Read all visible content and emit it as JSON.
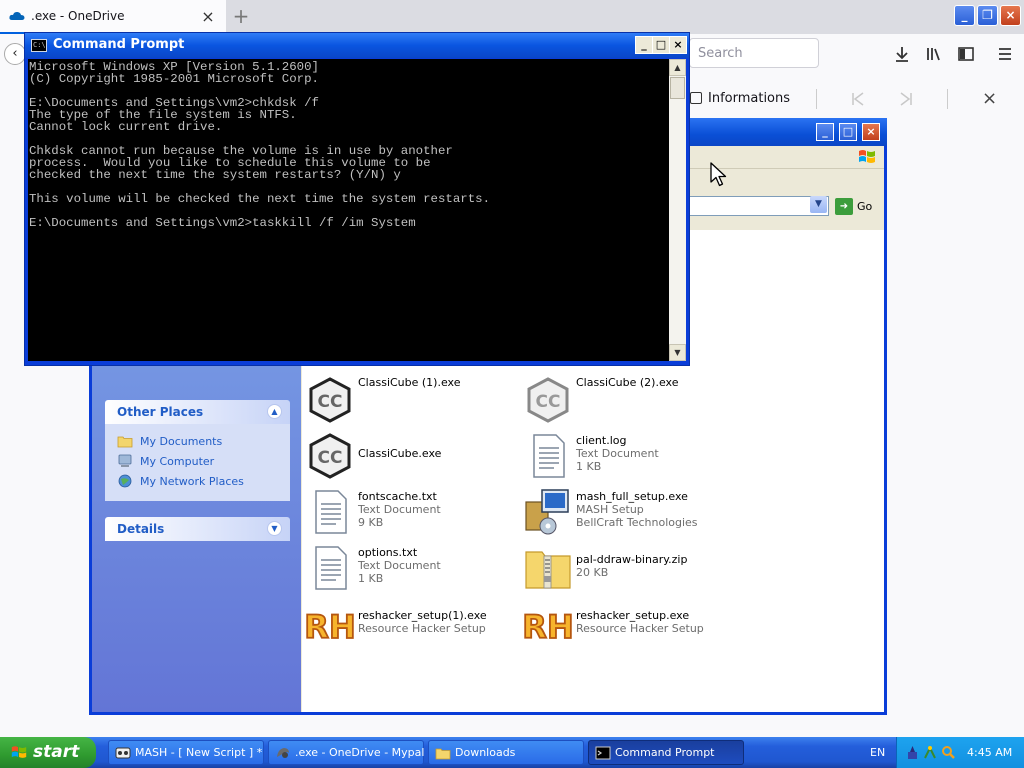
{
  "browser": {
    "tab_title": ".exe - OneDrive",
    "tab_close": "×",
    "new_tab": "+",
    "window_controls": {
      "minimize": "_",
      "restore": "❐",
      "close": "×"
    },
    "back": "‹",
    "search_placeholder": "Search",
    "find_bar": {
      "informations_label": "Informations",
      "close": "×"
    }
  },
  "explorer": {
    "go_label": "Go",
    "other_places": {
      "title": "Other Places",
      "items": [
        {
          "label": "My Documents",
          "icon": "folder-icon"
        },
        {
          "label": "My Computer",
          "icon": "computer-icon"
        },
        {
          "label": "My Network Places",
          "icon": "network-icon"
        }
      ]
    },
    "details": {
      "title": "Details"
    },
    "files": [
      {
        "name": "ClassiCube (1).exe",
        "sub1": "",
        "sub2": "",
        "icon": "classicube-icon"
      },
      {
        "name": "ClassiCube (2).exe",
        "sub1": "",
        "sub2": "",
        "icon": "classicube-icon"
      },
      {
        "name": "ClassiCube.exe",
        "sub1": "",
        "sub2": "",
        "icon": "classicube-icon"
      },
      {
        "name": "client.log",
        "sub1": "Text Document",
        "sub2": "1 KB",
        "icon": "text-document-icon"
      },
      {
        "name": "fontscache.txt",
        "sub1": "Text Document",
        "sub2": "9 KB",
        "icon": "text-document-icon"
      },
      {
        "name": "mash_full_setup.exe",
        "sub1": "MASH Setup",
        "sub2": "BellCraft Technologies",
        "icon": "setup-icon"
      },
      {
        "name": "options.txt",
        "sub1": "Text Document",
        "sub2": "1 KB",
        "icon": "text-document-icon"
      },
      {
        "name": "pal-ddraw-binary.zip",
        "sub1": "20 KB",
        "sub2": "",
        "icon": "zip-folder-icon"
      },
      {
        "name": "reshacker_setup(1).exe",
        "sub1": "Resource Hacker Setup",
        "sub2": "",
        "icon": "reshacker-icon"
      },
      {
        "name": "reshacker_setup.exe",
        "sub1": "Resource Hacker Setup",
        "sub2": "",
        "icon": "reshacker-icon"
      }
    ]
  },
  "cmd": {
    "title": "Command Prompt",
    "icon_text": "C:\\",
    "buttons": {
      "minimize": "_",
      "maximize": "□",
      "close": "×"
    },
    "text": "Microsoft Windows XP [Version 5.1.2600]\n(C) Copyright 1985-2001 Microsoft Corp.\n\nE:\\Documents and Settings\\vm2>chkdsk /f\nThe type of the file system is NTFS.\nCannot lock current drive.\n\nChkdsk cannot run because the volume is in use by another\nprocess.  Would you like to schedule this volume to be\nchecked the next time the system restarts? (Y/N) y\n\nThis volume will be checked the next time the system restarts.\n\nE:\\Documents and Settings\\vm2>taskkill /f /im System"
  },
  "taskbar": {
    "start_label": "start",
    "buttons": [
      {
        "label": "MASH - [ New Script ] *",
        "icon": "mash-icon",
        "active": false
      },
      {
        "label": ".exe - OneDrive - Mypal",
        "icon": "mypal-icon",
        "active": false
      },
      {
        "label": "Downloads",
        "icon": "folder-icon",
        "active": false
      },
      {
        "label": "Command Prompt",
        "icon": "cmd-icon",
        "active": true
      }
    ],
    "language": "EN",
    "clock": "4:45 AM"
  },
  "colors": {
    "xp_blue": "#0a3dd8",
    "taskbar_blue": "#245edb",
    "start_green": "#2f9a2f",
    "console_bg": "#000000",
    "console_fg": "#c0c0c0",
    "link_blue": "#215dc6"
  }
}
